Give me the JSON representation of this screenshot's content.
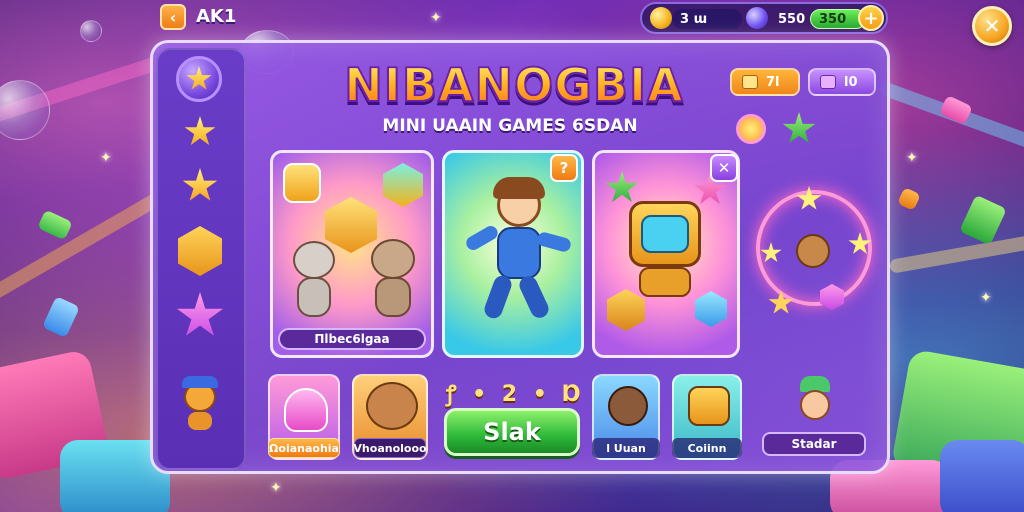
{
  "topbar": {
    "back_icon": "chevron-left-icon",
    "back_label": "AK1",
    "gold_amount": "3 ɯ",
    "gem_amount": "550",
    "green_amount": "350",
    "plus_label": "+",
    "close_label": "✕"
  },
  "header": {
    "title": "NIBANOGBIA",
    "subtitle": "MINI UAAIN GAMES 6SDAN"
  },
  "top_right": {
    "orange_pill_value": "7l",
    "purple_pill_value": "l0"
  },
  "cards": [
    {
      "label": "Πlbec6lgaa",
      "badge": ""
    },
    {
      "label": "",
      "badge": "?"
    },
    {
      "label": "",
      "badge": "✕"
    }
  ],
  "bottom": {
    "tiles": [
      {
        "label": "Ωoianaohia"
      },
      {
        "label": "Vhoanolooo"
      },
      {
        "label": "l Uuan"
      },
      {
        "label": "Coiinn"
      }
    ],
    "stats_text": "ꝭ • 2 • Ɒ",
    "play_label": "Slak",
    "side_label": "Stadar"
  },
  "colors": {
    "panel": "#8a55dc",
    "accent_orange": "#f59a12",
    "accent_green": "#2cb83a",
    "accent_purple": "#8a3ee0"
  }
}
